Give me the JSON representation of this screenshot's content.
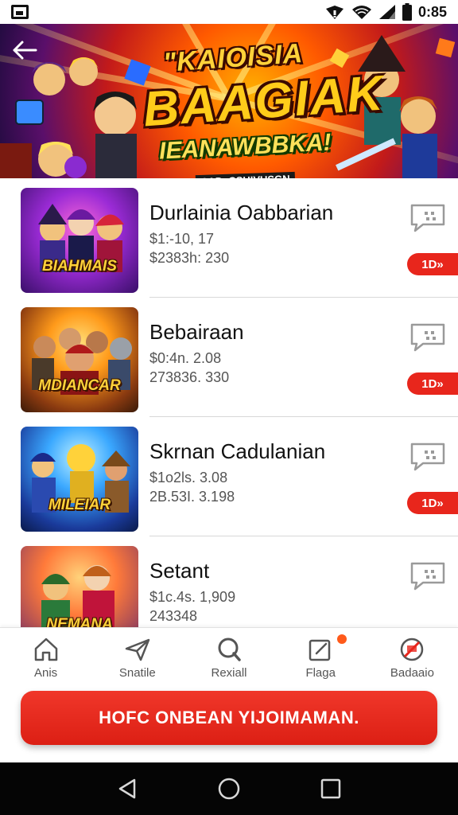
{
  "status_bar": {
    "time": "0:85",
    "icons": [
      "gallery-icon",
      "signal-icon",
      "wifi-icon",
      "cellular-icon",
      "battery-icon"
    ]
  },
  "banner": {
    "title_line1": "\"KAIOISIA",
    "title_line2": "BAAGIAK",
    "title_line3": "IEANAWBBKA!",
    "subtitle": "CAD. CSHIVUSGN",
    "back_icon": "arrow-left-icon"
  },
  "colors": {
    "accent": "#e8261c",
    "cta": "#dc1f14",
    "system_nav": "#050505"
  },
  "items": [
    {
      "title": "Durlainia Oabbarian",
      "price": "$1:-10, 17",
      "meta": "$2383h: 230",
      "thumb_label": "BIAHMAIS",
      "tag": "1D»"
    },
    {
      "title": "Bebairaan",
      "price": "$0:4n. 2.08",
      "meta": "273836. 330",
      "thumb_label": "MDIANCAR",
      "tag": "1D»"
    },
    {
      "title": "Skrnan Cadulanian",
      "price": "$1o2ls. 3.08",
      "meta": "2B.53I. 3.198",
      "thumb_label": "MILEIAR",
      "tag": "1D»"
    },
    {
      "title": "Setant",
      "price": "$1c.4s. 1,909",
      "meta": "243348",
      "thumb_label": "NEMANA",
      "tag": ""
    }
  ],
  "bottom_nav": [
    {
      "label": "Anis",
      "icon": "home-icon"
    },
    {
      "label": "Snatile",
      "icon": "send-icon"
    },
    {
      "label": "Rexiall",
      "icon": "search-icon"
    },
    {
      "label": "Flaga",
      "icon": "edit-icon"
    },
    {
      "label": "Badaaio",
      "icon": "blocked-icon"
    }
  ],
  "cta": {
    "label": "HOFC ONBEAN YIJOIMAMAN."
  },
  "system_nav": [
    "back-icon",
    "home-circle-icon",
    "recents-icon"
  ]
}
